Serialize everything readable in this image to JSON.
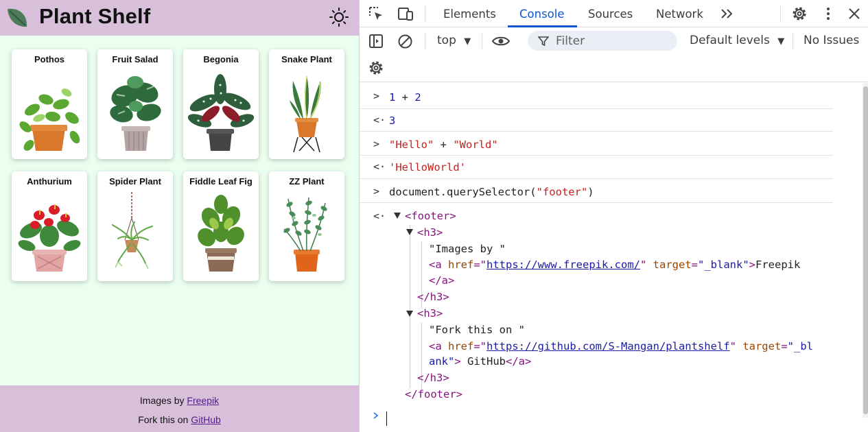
{
  "site": {
    "title": "Plant Shelf",
    "theme_toggle_icon": "sun-icon",
    "logo_icon": "leaf-icon",
    "plants": [
      {
        "name": "Pothos"
      },
      {
        "name": "Fruit Salad"
      },
      {
        "name": "Begonia"
      },
      {
        "name": "Snake Plant"
      },
      {
        "name": "Anthurium"
      },
      {
        "name": "Spider Plant"
      },
      {
        "name": "Fiddle Leaf Fig"
      },
      {
        "name": "ZZ Plant"
      }
    ],
    "footer": {
      "images_prefix": "Images by",
      "images_link": "Freepik",
      "fork_prefix": "Fork this on",
      "fork_link": "GitHub"
    }
  },
  "devtools": {
    "tabs": [
      "Elements",
      "Console",
      "Sources",
      "Network"
    ],
    "active_tab": "Console",
    "context": "top",
    "filter_placeholder": "Filter",
    "levels": "Default levels",
    "issues": "No Issues",
    "console": {
      "in1": {
        "a": "1",
        "op": " + ",
        "b": "2"
      },
      "out1": "3",
      "in2": {
        "a": "\"Hello\"",
        "op": " + ",
        "b": "\"World\""
      },
      "out2": "'HelloWorld'",
      "in3": {
        "pre": "document.querySelector(",
        "arg": "\"footer\"",
        "post": ")"
      },
      "out3": {
        "footer_open": "<footer>",
        "h3_open": "<h3>",
        "text1": "\"Images by \"",
        "a1_open": "<a",
        "href_attr": "href",
        "href1": "https://www.freepik.com/",
        "target_attr": "target",
        "target_val_1": "\"_blank\"",
        "a1_text": "Freepik",
        "a_close": "</a>",
        "h3_close": "</h3>",
        "text2": "\"Fork this on \"",
        "href2": "https://github.com/S-Mangan/plantshelf",
        "target_val_2a": "\"_bl",
        "target_val_2b": "ank\"",
        "a2_text": " GitHub",
        "footer_close": "</footer>"
      }
    },
    "colors": {
      "accent": "#0b57d0",
      "tag": "#881280",
      "string": "#c5221f",
      "number": "#1a1aa6",
      "attribute": "#994500"
    }
  }
}
